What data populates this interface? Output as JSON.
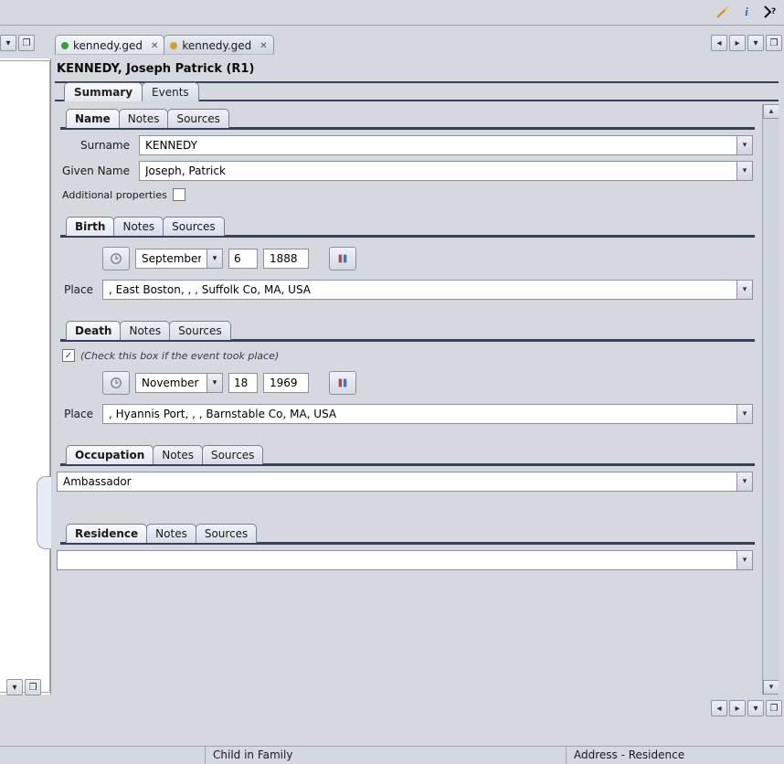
{
  "toolbar": {
    "info_tooltip": "i",
    "help_tooltip": "?"
  },
  "filetabs": [
    {
      "label": "kennedy.ged",
      "dot_color": "#35a035"
    },
    {
      "label": "kennedy.ged",
      "dot_color": "#d6a02a"
    }
  ],
  "title": "KENNEDY, Joseph Patrick (R1)",
  "main_tabs": {
    "summary": "Summary",
    "events": "Events"
  },
  "sections": {
    "name": {
      "tab_name": "Name",
      "tab_notes": "Notes",
      "tab_sources": "Sources",
      "surname_label": "Surname",
      "surname_value": "KENNEDY",
      "given_label": "Given Name",
      "given_value": "Joseph, Patrick",
      "additional_props_label": "Additional properties",
      "additional_props_checked": false
    },
    "birth": {
      "tab_name": "Birth",
      "tab_notes": "Notes",
      "tab_sources": "Sources",
      "month": "September",
      "day": "6",
      "year": "1888",
      "place_label": "Place",
      "place_value": ", East Boston, , , Suffolk Co, MA, USA"
    },
    "death": {
      "tab_name": "Death",
      "tab_notes": "Notes",
      "tab_sources": "Sources",
      "check_hint": "(Check this box if the event took place)",
      "checked": true,
      "month": "November",
      "day": "18",
      "year": "1969",
      "place_label": "Place",
      "place_value": ", Hyannis Port, , , Barnstable Co, MA, USA"
    },
    "occupation": {
      "tab_name": "Occupation",
      "tab_notes": "Notes",
      "tab_sources": "Sources",
      "value": "Ambassador"
    },
    "residence": {
      "tab_name": "Residence",
      "tab_notes": "Notes",
      "tab_sources": "Sources",
      "value": ""
    }
  },
  "statusbar": {
    "cell2": "Child in Family",
    "cell3": "Address - Residence"
  }
}
